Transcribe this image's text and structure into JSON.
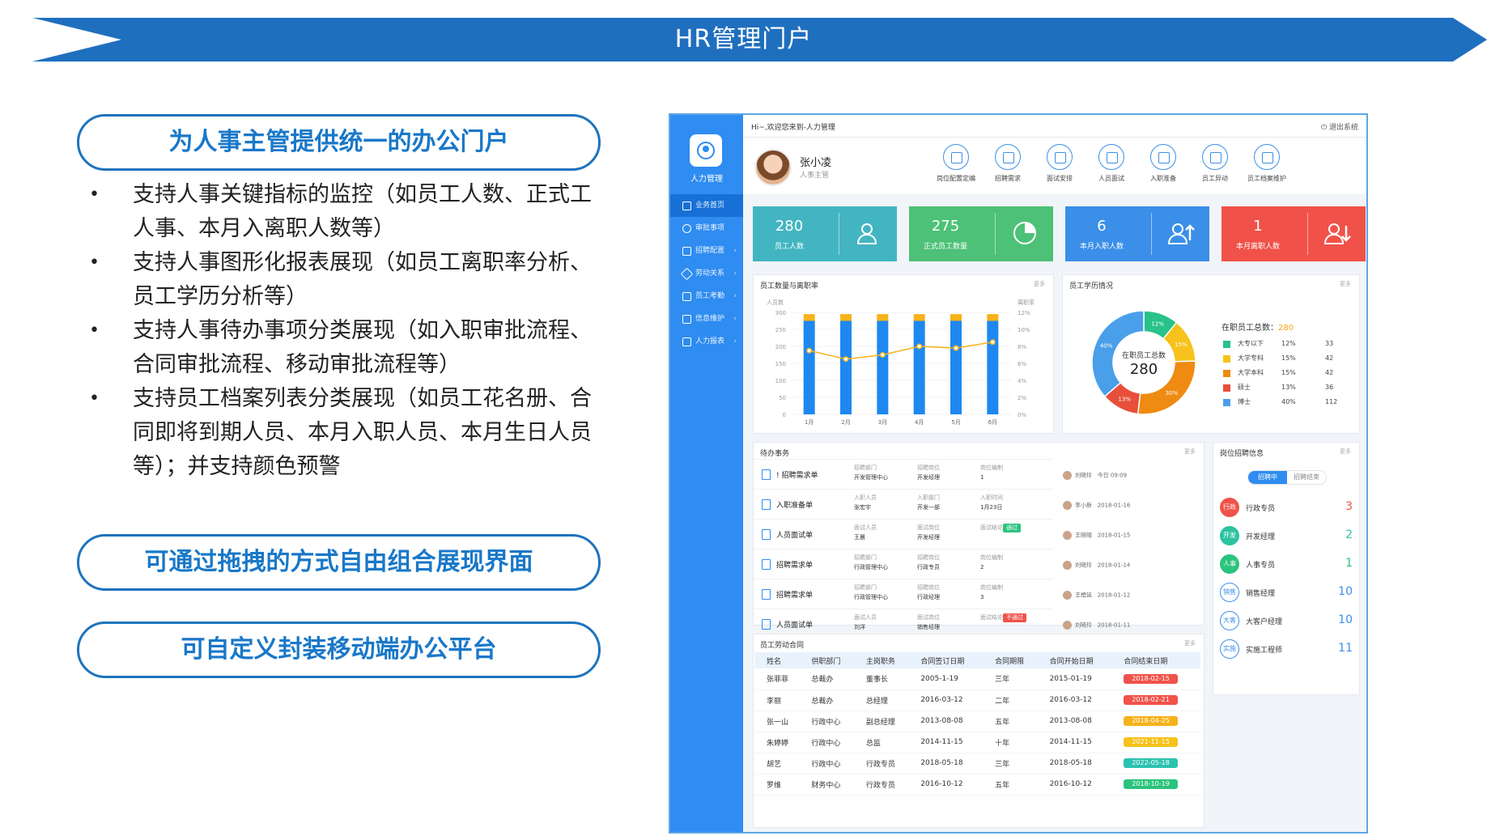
{
  "banner": {
    "title": "HR管理门户",
    "color": "#1f6fbf"
  },
  "left_panel": {
    "headline": "为人事主管提供统一的办公门户",
    "bullets": [
      "支持人事关键指标的监控（如员工人数、正式工人事、本月入离职人数等）",
      "支持人事图形化报表展现（如员工离职率分析、员工学历分析等）",
      "支持人事待办事项分类展现（如入职审批流程、合同审批流程、移动审批流程等）",
      "支持员工档案列表分类展现（如员工花名册、合同即将到期人员、本月入职人员、本月生日人员等）；并支持颜色预警"
    ],
    "callout_drag": "可通过拖拽的方式自由组合展现界面",
    "callout_mobile": "可自定义封装移动端办公平台"
  },
  "app": {
    "logo_label": "人力管理",
    "greeting": "Hi~,欢迎您来到-人力管理",
    "logout": "退出系统",
    "nav": [
      {
        "label": "业务首页",
        "icon": "home-icon",
        "active": true
      },
      {
        "label": "审批事项",
        "icon": "approval-icon"
      },
      {
        "label": "招聘配置",
        "icon": "recruit-icon"
      },
      {
        "label": "劳动关系",
        "icon": "labor-icon"
      },
      {
        "label": "员工考勤",
        "icon": "attendance-icon"
      },
      {
        "label": "信息维护",
        "icon": "info-icon"
      },
      {
        "label": "人力报表",
        "icon": "report-icon"
      }
    ],
    "profile": {
      "name": "张小凌",
      "role": "人事主管"
    },
    "quick_actions": [
      "岗位配置定编",
      "招聘需求",
      "面试安排",
      "人员面试",
      "入职准备",
      "员工异动",
      "员工档案维护"
    ],
    "stats": [
      {
        "value": "280",
        "label": "员工人数",
        "color": "#43b5c2"
      },
      {
        "value": "275",
        "label": "正式员工数量",
        "color": "#4dc177"
      },
      {
        "value": "6",
        "label": "本月入职人数",
        "color": "#3b8fe8"
      },
      {
        "value": "1",
        "label": "本月离职人数",
        "color": "#f0524a"
      }
    ],
    "chart1": {
      "title": "员工数量与离职率",
      "more": "更多",
      "left_unit": "人员数",
      "right_unit": "离职率"
    },
    "chart2": {
      "title": "员工学历情况",
      "more": "更多",
      "center_label": "在职员工总数",
      "center_value": "280",
      "summary_label": "在职员工总数：",
      "summary_value": "280",
      "legend": [
        {
          "name": "大专以下",
          "pct": "12%",
          "count": "33",
          "color": "#28c28a"
        },
        {
          "name": "大学专科",
          "pct": "15%",
          "count": "42",
          "color": "#f6c21b"
        },
        {
          "name": "大学本科",
          "pct": "15%",
          "count": "42",
          "color": "#ef8a12"
        },
        {
          "name": "硕士",
          "pct": "13%",
          "count": "36",
          "color": "#e84f3a"
        },
        {
          "name": "博士",
          "pct": "40%",
          "count": "112",
          "color": "#4a9fea"
        }
      ]
    },
    "todo": {
      "title": "待办事务",
      "more": "更多",
      "items": [
        {
          "name": "! 招聘需求单",
          "f1l": "招聘部门",
          "f1v": "开发管理中心",
          "f2l": "招聘岗位",
          "f2v": "开发经理",
          "f3l": "岗位编制",
          "f3v": "1",
          "who": "刘晓玲",
          "date": "今日 09:09"
        },
        {
          "name": "入职准备单",
          "f1l": "入职人员",
          "f1v": "张宏宇",
          "f2l": "入职部门",
          "f2v": "开发一部",
          "f3l": "入职时间",
          "f3v": "1月23日",
          "who": "李小新",
          "date": "2018-01-16"
        },
        {
          "name": "人员面试单",
          "f1l": "面试人员",
          "f1v": "王晨",
          "f2l": "面试岗位",
          "f2v": "开发经理",
          "f3l": "面试结论",
          "f3v": "通过",
          "tag": "#2bc37d",
          "who": "王晓晴",
          "date": "2018-01-15"
        },
        {
          "name": "招聘需求单",
          "f1l": "招聘部门",
          "f1v": "行政管理中心",
          "f2l": "招聘岗位",
          "f2v": "行政专员",
          "f3l": "岗位编制",
          "f3v": "2",
          "who": "刘晓玲",
          "date": "2018-01-14"
        },
        {
          "name": "招聘需求单",
          "f1l": "招聘部门",
          "f1v": "行政管理中心",
          "f2l": "招聘岗位",
          "f2v": "行政经理",
          "f3l": "岗位编制",
          "f3v": "3",
          "who": "王梧延",
          "date": "2018-01-12"
        },
        {
          "name": "人员面试单",
          "f1l": "面试人员",
          "f1v": "刘洋",
          "f2l": "面试岗位",
          "f2v": "销售经理",
          "f3l": "面试结论",
          "f3v": "不通过",
          "tag": "#f0524a",
          "who": "刘晓玲",
          "date": "2018-01-11"
        }
      ]
    },
    "recruit": {
      "title": "岗位招聘信息",
      "more": "更多",
      "tab_active": "招聘中",
      "tab_other": "招聘结束",
      "items": [
        {
          "badge": "行政",
          "name": "行政专员",
          "count": "3",
          "color": "#f0524a",
          "outline": false
        },
        {
          "badge": "开发",
          "name": "开发经理",
          "count": "2",
          "color": "#2bc3a0",
          "outline": false
        },
        {
          "badge": "人事",
          "name": "人事专员",
          "count": "1",
          "color": "#2bc37d",
          "outline": false
        },
        {
          "badge": "销售",
          "name": "销售经理",
          "count": "10",
          "color": "#3b8fe8",
          "outline": true
        },
        {
          "badge": "大客",
          "name": "大客户经理",
          "count": "10",
          "color": "#3b8fe8",
          "outline": true
        },
        {
          "badge": "实施",
          "name": "实施工程师",
          "count": "11",
          "color": "#3b8fe8",
          "outline": true
        }
      ]
    },
    "contracts": {
      "title": "员工劳动合同",
      "more": "更多",
      "headers": [
        "姓名",
        "供职部门",
        "主岗职务",
        "合同签订日期",
        "合同期限",
        "合同开始日期",
        "合同结束日期"
      ],
      "rows": [
        [
          "张菲菲",
          "总裁办",
          "董事长",
          "2005-1-19",
          "三年",
          "2015-01-19",
          "2018-02-15",
          "#f0524a"
        ],
        [
          "李丽",
          "总裁办",
          "总经理",
          "2016-03-12",
          "二年",
          "2016-03-12",
          "2018-02-21",
          "#f0524a"
        ],
        [
          "张一山",
          "行政中心",
          "副总经理",
          "2013-08-08",
          "五年",
          "2013-08-08",
          "2018-04-25",
          "#f6b21b"
        ],
        [
          "朱婷婷",
          "行政中心",
          "总监",
          "2014-11-15",
          "十年",
          "2014-11-15",
          "2021-11-15",
          "#f6c21b"
        ],
        [
          "胡艺",
          "行政中心",
          "行政专员",
          "2018-05-18",
          "三年",
          "2018-05-18",
          "2022-05-18",
          "#2bc3b0"
        ],
        [
          "罗维",
          "财务中心",
          "行政专员",
          "2016-10-12",
          "五年",
          "2016-10-12",
          "2018-10-19",
          "#2bc37d"
        ]
      ]
    }
  },
  "chart_data": [
    {
      "type": "bar",
      "title": "员工数量与离职率",
      "categories": [
        "1月",
        "2月",
        "3月",
        "4月",
        "5月",
        "6月"
      ],
      "series": [
        {
          "kind": "bar",
          "values": [
            275,
            275,
            275,
            275,
            275,
            275
          ],
          "color": "#1e88f0"
        },
        {
          "kind": "bar-stack-top",
          "values": [
            20,
            20,
            20,
            20,
            20,
            20
          ],
          "color": "#f6b21b"
        },
        {
          "kind": "line",
          "axis": "right",
          "values": [
            7.5,
            6.5,
            7,
            8,
            7.8,
            8.5
          ],
          "color": "#f6b21b"
        }
      ],
      "ylim": [
        0,
        300
      ],
      "yticks": [
        0,
        50,
        100,
        150,
        200,
        250,
        300
      ],
      "y2lim": [
        0,
        12
      ],
      "y2ticks": [
        "0%",
        "2%",
        "4%",
        "6%",
        "8%",
        "10%",
        "12%"
      ],
      "ylabel": "人员数",
      "y2label": "离职率"
    },
    {
      "type": "pie",
      "title": "员工学历情况",
      "labels": [
        "大专以下",
        "大学专科",
        "大学本科",
        "硕士",
        "博士"
      ],
      "values": [
        12,
        15,
        30,
        13,
        40
      ],
      "slice_labels": [
        "12%",
        "15%",
        "30%",
        "13%",
        "40%"
      ],
      "colors": [
        "#28c28a",
        "#f6c21b",
        "#ef8a12",
        "#e84f3a",
        "#4a9fea"
      ]
    }
  ]
}
